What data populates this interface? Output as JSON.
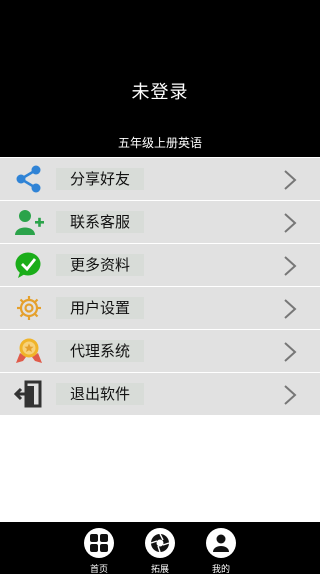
{
  "header": {
    "title": "未登录",
    "subtitle": "五年级上册英语"
  },
  "menu": [
    {
      "label": "分享好友",
      "icon": "share-icon",
      "color": "#2f83d6"
    },
    {
      "label": "联系客服",
      "icon": "add-user-icon",
      "color": "#2ba34a"
    },
    {
      "label": "更多资料",
      "icon": "wechat-icon",
      "color": "#1aad19"
    },
    {
      "label": "用户设置",
      "icon": "gear-icon",
      "color": "#e5a02c"
    },
    {
      "label": "代理系统",
      "icon": "award-icon",
      "color": "#e8b030"
    },
    {
      "label": "退出软件",
      "icon": "exit-icon",
      "color": "#333333"
    }
  ],
  "footer": {
    "tabs": [
      {
        "label": "首页",
        "icon": "home-grid-icon"
      },
      {
        "label": "拓展",
        "icon": "aperture-icon"
      },
      {
        "label": "我的",
        "icon": "user-icon"
      }
    ]
  }
}
